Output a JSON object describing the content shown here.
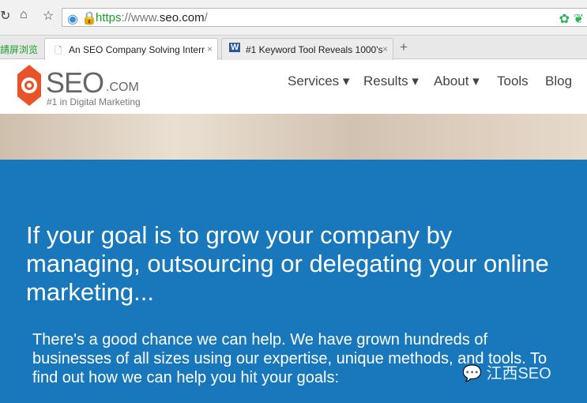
{
  "browser": {
    "url_scheme": "https",
    "url_sep": "://www.",
    "url_host": "seo.com",
    "url_tail": "/",
    "side_tab": "請屏浏览",
    "tabs": [
      {
        "label": "An SEO Company Solving Interr",
        "active": true
      },
      {
        "label": "#1 Keyword Tool Reveals 1000's",
        "active": false
      }
    ],
    "new_tab": "+",
    "close": "×"
  },
  "site": {
    "logo_main": "SEO",
    "logo_suffix": ".COM",
    "tagline": "#1 in Digital Marketing",
    "nav": [
      {
        "label": "Services",
        "dropdown": true
      },
      {
        "label": "Results",
        "dropdown": true
      },
      {
        "label": "About",
        "dropdown": true
      },
      {
        "label": "Tools",
        "dropdown": false
      },
      {
        "label": "Blog",
        "dropdown": false
      }
    ],
    "headline": "If your goal is to grow your company by managing, outsourcing or delegating your online marketing...",
    "body": "There's a good chance we can help. We have grown hundreds of businesses of all sizes using our expertise, unique methods, and tools. To find out how we can help you hit your goals:",
    "accent": "#1878bb",
    "logo_color": "#e8542a"
  },
  "watermark": "江西SEO"
}
